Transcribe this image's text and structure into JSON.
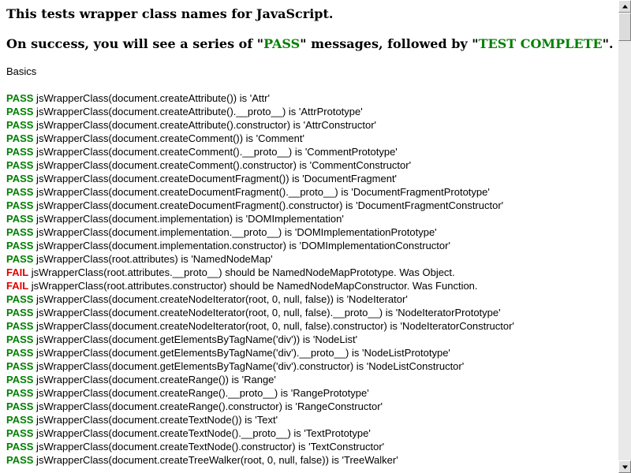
{
  "header": {
    "line1": "This tests wrapper class names for JavaScript.",
    "line2_prefix": "On success, you will see a series of \"",
    "line2_pass": "PASS",
    "line2_middle": "\" messages, followed by \"",
    "line2_complete": "TEST COMPLETE",
    "line2_suffix": "\"."
  },
  "section_title": "Basics",
  "results": [
    {
      "status": "PASS",
      "text": " jsWrapperClass(document.createAttribute()) is 'Attr'"
    },
    {
      "status": "PASS",
      "text": " jsWrapperClass(document.createAttribute().__proto__) is 'AttrPrototype'"
    },
    {
      "status": "PASS",
      "text": " jsWrapperClass(document.createAttribute().constructor) is 'AttrConstructor'"
    },
    {
      "status": "PASS",
      "text": " jsWrapperClass(document.createComment()) is 'Comment'"
    },
    {
      "status": "PASS",
      "text": " jsWrapperClass(document.createComment().__proto__) is 'CommentPrototype'"
    },
    {
      "status": "PASS",
      "text": " jsWrapperClass(document.createComment().constructor) is 'CommentConstructor'"
    },
    {
      "status": "PASS",
      "text": " jsWrapperClass(document.createDocumentFragment()) is 'DocumentFragment'"
    },
    {
      "status": "PASS",
      "text": " jsWrapperClass(document.createDocumentFragment().__proto__) is 'DocumentFragmentPrototype'"
    },
    {
      "status": "PASS",
      "text": " jsWrapperClass(document.createDocumentFragment().constructor) is 'DocumentFragmentConstructor'"
    },
    {
      "status": "PASS",
      "text": " jsWrapperClass(document.implementation) is 'DOMImplementation'"
    },
    {
      "status": "PASS",
      "text": " jsWrapperClass(document.implementation.__proto__) is 'DOMImplementationPrototype'"
    },
    {
      "status": "PASS",
      "text": " jsWrapperClass(document.implementation.constructor) is 'DOMImplementationConstructor'"
    },
    {
      "status": "PASS",
      "text": " jsWrapperClass(root.attributes) is 'NamedNodeMap'"
    },
    {
      "status": "FAIL",
      "text": " jsWrapperClass(root.attributes.__proto__) should be NamedNodeMapPrototype. Was Object."
    },
    {
      "status": "FAIL",
      "text": " jsWrapperClass(root.attributes.constructor) should be NamedNodeMapConstructor. Was Function."
    },
    {
      "status": "PASS",
      "text": " jsWrapperClass(document.createNodeIterator(root, 0, null, false)) is 'NodeIterator'"
    },
    {
      "status": "PASS",
      "text": " jsWrapperClass(document.createNodeIterator(root, 0, null, false).__proto__) is 'NodeIteratorPrototype'"
    },
    {
      "status": "PASS",
      "text": " jsWrapperClass(document.createNodeIterator(root, 0, null, false).constructor) is 'NodeIteratorConstructor'"
    },
    {
      "status": "PASS",
      "text": " jsWrapperClass(document.getElementsByTagName('div')) is 'NodeList'"
    },
    {
      "status": "PASS",
      "text": " jsWrapperClass(document.getElementsByTagName('div').__proto__) is 'NodeListPrototype'"
    },
    {
      "status": "PASS",
      "text": " jsWrapperClass(document.getElementsByTagName('div').constructor) is 'NodeListConstructor'"
    },
    {
      "status": "PASS",
      "text": " jsWrapperClass(document.createRange()) is 'Range'"
    },
    {
      "status": "PASS",
      "text": " jsWrapperClass(document.createRange().__proto__) is 'RangePrototype'"
    },
    {
      "status": "PASS",
      "text": " jsWrapperClass(document.createRange().constructor) is 'RangeConstructor'"
    },
    {
      "status": "PASS",
      "text": " jsWrapperClass(document.createTextNode()) is 'Text'"
    },
    {
      "status": "PASS",
      "text": " jsWrapperClass(document.createTextNode().__proto__) is 'TextPrototype'"
    },
    {
      "status": "PASS",
      "text": " jsWrapperClass(document.createTextNode().constructor) is 'TextConstructor'"
    },
    {
      "status": "PASS",
      "text": " jsWrapperClass(document.createTreeWalker(root, 0, null, false)) is 'TreeWalker'"
    }
  ],
  "colors": {
    "pass": "#008000",
    "fail": "#e00000"
  },
  "icons": {
    "scroll_up": "arrow-up-icon",
    "scroll_down": "arrow-down-icon"
  }
}
